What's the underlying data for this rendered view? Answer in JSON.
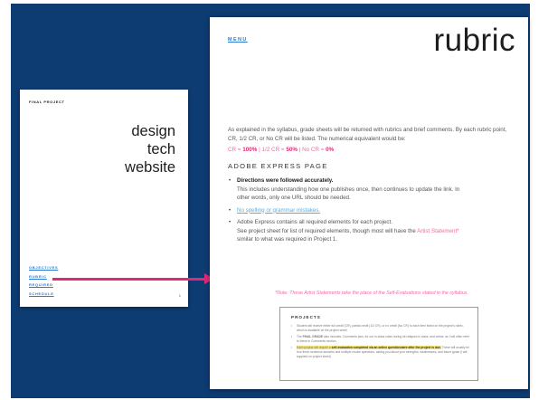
{
  "left_page": {
    "label": "FINAL PROJECT",
    "title_lines": [
      "design",
      "tech",
      "website"
    ],
    "nav": [
      "OBJECTIVES",
      "RUBRIC",
      "REQUIRED",
      "SCHEDULE"
    ],
    "page_number": "1"
  },
  "right_page": {
    "menu": "MENU",
    "title": "rubric",
    "intro": "As explained in the syllabus, grade sheets will be returned with rubrics and brief comments. By each rubric point, CR, 1/2 CR, or No CR will be listed. The numerical equivalent would be:",
    "scale": {
      "cr_label": "CR = ",
      "cr_value": "100%",
      "sep1": " | ",
      "half_label": "1/2 CR = ",
      "half_value": "50%",
      "sep2": " | ",
      "no_label": "No CR = ",
      "no_value": "0%"
    },
    "section": "ADOBE EXPRESS PAGE",
    "items": [
      {
        "heading": "Directions were followed accurately.",
        "line1": "This includes understanding how one publishes once, then continues to update the link. In",
        "line2": "other words, only one URL should be needed."
      },
      {
        "link": "No spelling or grammar mistakes."
      },
      {
        "line1": "Adobe Express contains all required elements for each project.",
        "line2_pre": "See project sheet for list of required elements, though most will have the ",
        "line2_pink": "Artist Statement",
        "line2_post": "*",
        "line3": "similar to what was required in Project 1."
      }
    ],
    "note": "*Note: These Artist Statements take the place of the Self-Evaluations stated in the syllabus.",
    "projects": {
      "title": "PROJECTS",
      "items": [
        {
          "text": "Student will receive either full credit (CR), partial credit (1/2 CR), or no credit (No CR) to each item listed on the project's rubric, which is available on the project sheet."
        },
        {
          "pre": "The ",
          "bold": "FINAL GRADE",
          "post": " also includes: Comments plus, for our in-class votes during all critiques in class, and online, as I will often refer to these in Comments section."
        },
        {
          "hl_pre": "Each project will require a ",
          "hl_bold": "self-evaluation completed via an online questionnaire after the project is due.",
          "post": " These will usually be four three-sentence answers and multiple choice questions, asking you about your strengths, weaknesses, and future goals (I will supplied on project sheet)."
        }
      ]
    }
  },
  "colors": {
    "background": "#0d3c73",
    "accent_pink": "#e3277a",
    "link_blue": "#2d7ad6",
    "highlight": "#f6e47a"
  }
}
